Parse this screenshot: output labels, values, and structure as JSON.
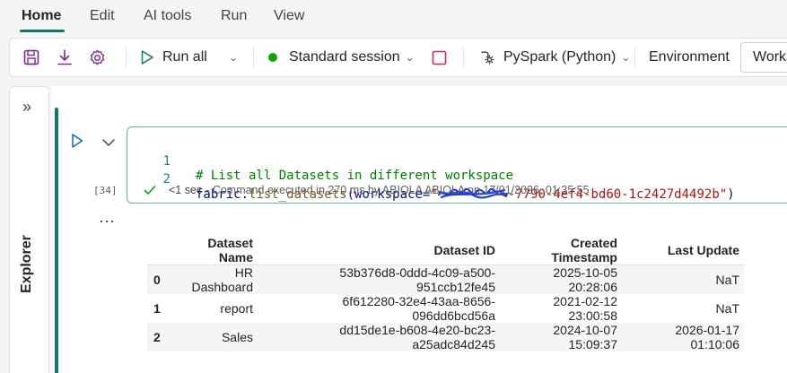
{
  "menu": {
    "tabs": [
      {
        "label": "Home",
        "active": true
      },
      {
        "label": "Edit"
      },
      {
        "label": "AI tools"
      },
      {
        "label": "Run"
      },
      {
        "label": "View"
      }
    ]
  },
  "toolbar": {
    "save_icon": "save-icon",
    "download_icon": "download-icon",
    "settings_icon": "gear-icon",
    "run_all_label": "Run all",
    "session_label": "Standard session",
    "session_status_color": "#13a10e",
    "language_label": "PySpark (Python)",
    "environment_label": "Environment",
    "workspace_label": "Works"
  },
  "explorer": {
    "label": "Explorer"
  },
  "cell": {
    "execution_count": "[34]",
    "lines": [
      {
        "number": "1",
        "text": "# List all Datasets in different workspace"
      },
      {
        "number": "2",
        "prefix": "fabric.",
        "fn": "list_datasets",
        "arg": "(workspace=",
        "str_open": "\"",
        "str_rest": "-7790-4ef4-bd60-1c2427d4492b\"",
        "close": ")"
      }
    ],
    "status_time": "<1 sec",
    "status_text": "- Command executed in 270 ms by ABIOLA ABIOLA on 17/01/2026, 01:35:55"
  },
  "output_table": {
    "columns": [
      "",
      "Dataset Name",
      "Dataset ID",
      "Created Timestamp",
      "Last Update"
    ],
    "rows": [
      [
        "0",
        "HR Dashboard",
        "53b376d8-0ddd-4c09-a500-951ccb12fe45",
        "2025-10-05 20:28:06",
        "NaT"
      ],
      [
        "1",
        "report",
        "6f612280-32e4-43aa-8656-096dd6bcd56a",
        "2021-02-12 23:00:58",
        "NaT"
      ],
      [
        "2",
        "Sales",
        "dd15de1e-b608-4e20-bc23-a25adc84d245",
        "2024-10-07 15:09:37",
        "2026-01-17 01:10:06"
      ]
    ]
  },
  "colors": {
    "accent": "#117865",
    "redaction": "#1f3fd6"
  }
}
